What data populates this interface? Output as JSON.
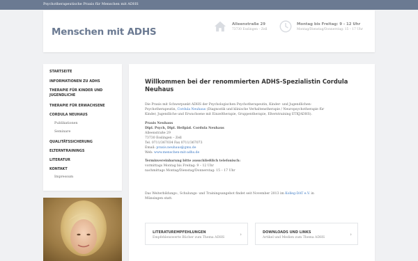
{
  "topbar": {
    "text": "Psychotherapeutische Praxis für Menschen mit ADHS"
  },
  "header": {
    "site_title": "Menschen mit ADHS",
    "address_strong": "Alleenstraße 29",
    "address_small": "73730 Esslingen – Zell",
    "hours_strong": "Montag bis Freitag: 9 - 12 Uhr",
    "hours_small": "Montag/Dienstag/Donnerstag: 15 – 17 Uhr",
    "address_icon": "home-icon",
    "hours_icon": "clock-icon"
  },
  "nav": {
    "items": [
      {
        "label": "STARTSEITE"
      },
      {
        "label": "INFORMATIONEN ZU ADHS"
      },
      {
        "label": "THERAPIE FÜR KINDER UND"
      },
      {
        "label": "JUGENDLICHE"
      },
      {
        "label": "THERAPIE FÜR ERWACHSENE"
      },
      {
        "label": "CORDULA NEUHAUS"
      },
      {
        "label": "Publikationen"
      },
      {
        "label": "Seminare"
      },
      {
        "label": "QUALITÄTSSICHERUNG"
      },
      {
        "label": "ELTERNTRAININGS"
      },
      {
        "label": "LITERATUR"
      },
      {
        "label": "KONTAKT"
      },
      {
        "label": "Impressum"
      }
    ]
  },
  "main": {
    "title": "Willkommen bei der renommierten ADHS-Spezialistin Cordula Neuhaus",
    "intro": {
      "l1": "Die Praxis mit Schwerpunkt ADHS der Psychologischen Psychotherapeutin, Kinder- und Jugendlichen-",
      "l2_a": "Psychotherapeutin, ",
      "l2_link": "Cordula Neuhaus",
      "l2_b": " (Diagnostik und klinische Verhaltenstherapie / Neuropsychotherapie für",
      "l3": "Kinder, Jugendliche und Erwachsene mit Einzeltherapie, Gruppentherapie, Elterntraining ETKJADHS)."
    },
    "contact": {
      "l1": "Praxis Neuhaus",
      "l2": "Dipl. Psych, Dipl. Heilpäd. Cordula Neuhaus",
      "l3": "Alleenstraße 29",
      "l4": "73730 Esslingen – Zell",
      "l5": "Tel. 0711/367034 Fax 0711/367073",
      "email_label": "Email: ",
      "email": "praxis.neuhaus@gmx.de",
      "web_label": "Web: ",
      "web": "www.menschen-mit-adhs.de"
    },
    "appointments": {
      "l1": "Terminvereinbarung bitte ausschließlich telefonisch:",
      "l2": "vormittags Montag bis Freitag: 9 – 12 Uhr",
      "l3": "nachmittags Montag/Dienstag/Donnerstag: 15 – 17 Uhr"
    },
    "training": {
      "l1_a": "Das Weiterbildungs-, Schulungs- und Trainingsangebot findet seit November 2013 im ",
      "l1_link": "Kolleg-DAT e.V.",
      "l1_b": " in",
      "l2": "Münsingen statt."
    },
    "cards": [
      {
        "title": "LITERATUREMPFEHLUNGEN",
        "subtitle": "Empfehlenswerte Bücher zum Thema ADHS",
        "chevron": "›"
      },
      {
        "title": "DOWNLOADS UND LINKS",
        "subtitle": "Artikel und Medien zum Thema ADHS",
        "chevron": "›"
      }
    ]
  },
  "colors": {
    "topbar": "#6b7a92",
    "title": "#6b7a92",
    "link": "#3b78c3",
    "background": "#f0f1f3"
  }
}
